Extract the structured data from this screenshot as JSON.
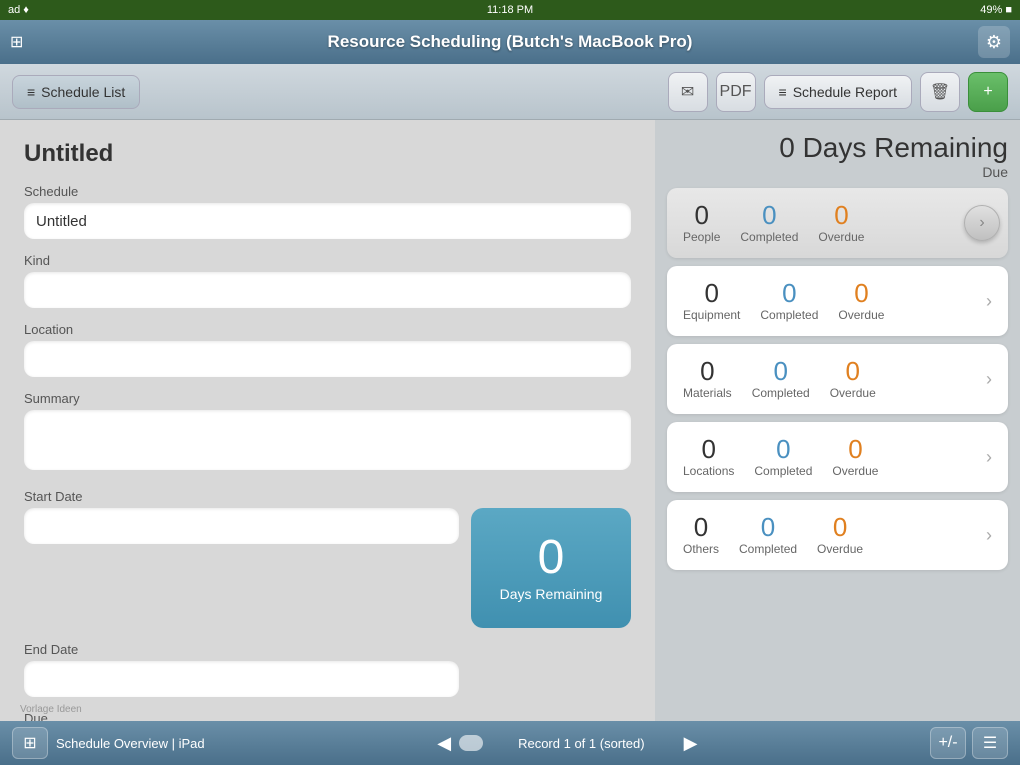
{
  "statusBar": {
    "carrier": "ad ♦",
    "time": "11:18 PM",
    "battery": "49% ■"
  },
  "titleBar": {
    "title": "Resource Scheduling (Butch's MacBook Pro)",
    "settingsIcon": "⚙"
  },
  "toolbar": {
    "scheduleListLabel": "Schedule List",
    "emailIcon": "✉",
    "pdfLabel": "PDF",
    "scheduleReportLabel": "Schedule Report",
    "deleteIcon": "🗑",
    "addIcon": "+"
  },
  "leftPanel": {
    "title": "Untitled",
    "scheduleLabel": "Schedule",
    "scheduleValue": "Untitled",
    "kindLabel": "Kind",
    "kindValue": "",
    "locationLabel": "Location",
    "locationValue": "",
    "summaryLabel": "Summary",
    "summaryValue": "",
    "startDateLabel": "Start Date",
    "startDateValue": "",
    "endDateLabel": "End Date",
    "endDateValue": "",
    "dueLabel": "Due",
    "dueValue": "",
    "daysRemainingNumber": "0",
    "daysRemainingLabel": "Days Remaining"
  },
  "rightPanel": {
    "daysSummary": "0 Days Remaining",
    "dueLabel": "Due",
    "resources": [
      {
        "name": "People",
        "count": 0,
        "completed": 0,
        "overdue": 0,
        "completedLabel": "Completed",
        "overdueLabel": "Overdue",
        "isActive": true
      },
      {
        "name": "Equipment",
        "count": 0,
        "completed": 0,
        "overdue": 0,
        "completedLabel": "Completed",
        "overdueLabel": "Overdue",
        "isActive": false
      },
      {
        "name": "Materials",
        "count": 0,
        "completed": 0,
        "overdue": 0,
        "completedLabel": "Completed",
        "overdueLabel": "Overdue",
        "isActive": false
      },
      {
        "name": "Locations",
        "count": 0,
        "completed": 0,
        "overdue": 0,
        "completedLabel": "Completed",
        "overdueLabel": "Overdue",
        "isActive": false
      },
      {
        "name": "Others",
        "count": 0,
        "completed": 0,
        "overdue": 0,
        "completedLabel": "Completed",
        "overdueLabel": "Overdue",
        "isActive": false
      }
    ]
  },
  "bottomBar": {
    "appLabel": "Schedule Overview | iPad",
    "recordInfo": "Record 1 of 1 (sorted)",
    "prevIcon": "◀",
    "nextIcon": "▶",
    "addRemoveLabel": "+/-",
    "menuIcon": "☰"
  },
  "watermark": "Vorlage Ideen"
}
